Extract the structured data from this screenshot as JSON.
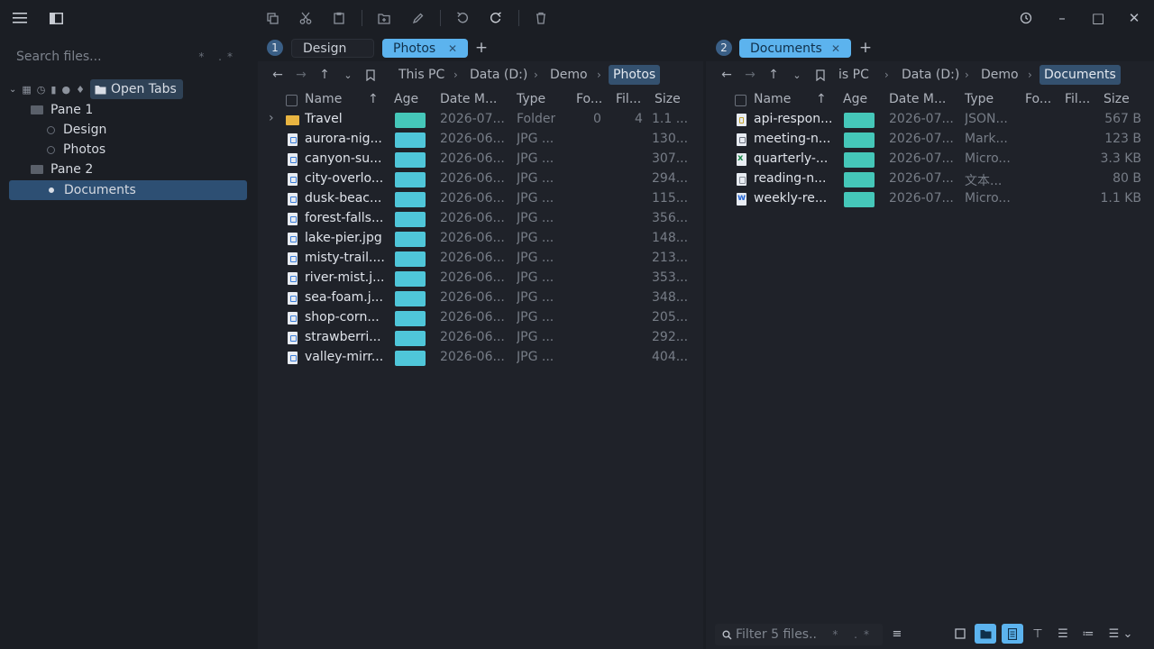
{
  "toolbar": {
    "icons": [
      "menu-icon",
      "sidebar-toggle-icon",
      "copy-icon",
      "cut-icon",
      "paste-icon",
      "new-folder-icon",
      "rename-icon",
      "undo-icon",
      "redo-icon",
      "delete-icon",
      "history-icon"
    ],
    "window": {
      "minimize": "–",
      "maximize": "□",
      "close": "✕"
    }
  },
  "sidebar": {
    "search_placeholder": "Search files...",
    "search_opts": "* .*",
    "open_tabs_label": "Open Tabs",
    "tree": [
      {
        "label": "Pane 1",
        "type": "pane"
      },
      {
        "label": "Design",
        "type": "tab"
      },
      {
        "label": "Photos",
        "type": "tab"
      },
      {
        "label": "Pane 2",
        "type": "pane"
      },
      {
        "label": "Documents",
        "type": "tab",
        "selected": true
      }
    ]
  },
  "pane1": {
    "number": "1",
    "tabs": [
      {
        "label": "Design",
        "active": false
      },
      {
        "label": "Photos",
        "active": true,
        "close": "✕"
      }
    ],
    "add_tab": "+",
    "breadcrumb": [
      "This PC",
      "Data (D:)",
      "Demo",
      "Photos"
    ],
    "columns": [
      "Name",
      "Age",
      "Date M...",
      "Type",
      "Fo...",
      "Fil...",
      "Size"
    ],
    "sort_arrow": "↑",
    "rows": [
      {
        "name": "Travel",
        "kind": "folder",
        "date": "2026-07...",
        "type": "Folder",
        "folders": "0",
        "files": "4",
        "size": "1.1 ..."
      },
      {
        "name": "aurora-nig...",
        "kind": "jpg",
        "date": "2026-06...",
        "type": "JPG ...",
        "folders": "",
        "files": "",
        "size": "130...."
      },
      {
        "name": "canyon-su...",
        "kind": "jpg",
        "date": "2026-06...",
        "type": "JPG ...",
        "folders": "",
        "files": "",
        "size": "307...."
      },
      {
        "name": "city-overlo...",
        "kind": "jpg",
        "date": "2026-06...",
        "type": "JPG ...",
        "folders": "",
        "files": "",
        "size": "294...."
      },
      {
        "name": "dusk-beac...",
        "kind": "jpg",
        "date": "2026-06...",
        "type": "JPG ...",
        "folders": "",
        "files": "",
        "size": "115...."
      },
      {
        "name": "forest-falls...",
        "kind": "jpg",
        "date": "2026-06...",
        "type": "JPG ...",
        "folders": "",
        "files": "",
        "size": "356...."
      },
      {
        "name": "lake-pier.jpg",
        "kind": "jpg",
        "date": "2026-06...",
        "type": "JPG ...",
        "folders": "",
        "files": "",
        "size": "148...."
      },
      {
        "name": "misty-trail....",
        "kind": "jpg",
        "date": "2026-06...",
        "type": "JPG ...",
        "folders": "",
        "files": "",
        "size": "213...."
      },
      {
        "name": "river-mist.j...",
        "kind": "jpg",
        "date": "2026-06...",
        "type": "JPG ...",
        "folders": "",
        "files": "",
        "size": "353...."
      },
      {
        "name": "sea-foam.j...",
        "kind": "jpg",
        "date": "2026-06...",
        "type": "JPG ...",
        "folders": "",
        "files": "",
        "size": "348...."
      },
      {
        "name": "shop-corn...",
        "kind": "jpg",
        "date": "2026-06...",
        "type": "JPG ...",
        "folders": "",
        "files": "",
        "size": "205...."
      },
      {
        "name": "strawberri...",
        "kind": "jpg",
        "date": "2026-06...",
        "type": "JPG ...",
        "folders": "",
        "files": "",
        "size": "292...."
      },
      {
        "name": "valley-mirr...",
        "kind": "jpg",
        "date": "2026-06...",
        "type": "JPG ...",
        "folders": "",
        "files": "",
        "size": "404...."
      }
    ]
  },
  "pane2": {
    "number": "2",
    "tabs": [
      {
        "label": "Documents",
        "active": true,
        "close": "✕"
      }
    ],
    "add_tab": "+",
    "breadcrumb": [
      "is PC",
      "Data (D:)",
      "Demo",
      "Documents"
    ],
    "columns": [
      "Name",
      "Age",
      "Date M...",
      "Type",
      "Fo...",
      "Fil...",
      "Size"
    ],
    "sort_arrow": "↑",
    "rows": [
      {
        "name": "api-respon...",
        "kind": "json",
        "date": "2026-07...",
        "type": "JSON...",
        "size": "567 B"
      },
      {
        "name": "meeting-n...",
        "kind": "md",
        "date": "2026-07...",
        "type": "Mark...",
        "size": "123 B"
      },
      {
        "name": "quarterly-...",
        "kind": "xls",
        "date": "2026-07...",
        "type": "Micro...",
        "size": "3.3 KB"
      },
      {
        "name": "reading-n...",
        "kind": "txt",
        "date": "2026-07...",
        "type": "文本...",
        "size": "80 B"
      },
      {
        "name": "weekly-re...",
        "kind": "doc",
        "date": "2026-07...",
        "type": "Micro...",
        "size": "1.1 KB"
      }
    ],
    "filter_placeholder": "Filter 5 files..",
    "filter_opts": "* .*"
  },
  "colors": {
    "accent": "#5cb3ee",
    "age_photos": "#4fc6d9",
    "age_docs": "#45c7b9",
    "selection": "#2d4f73"
  }
}
